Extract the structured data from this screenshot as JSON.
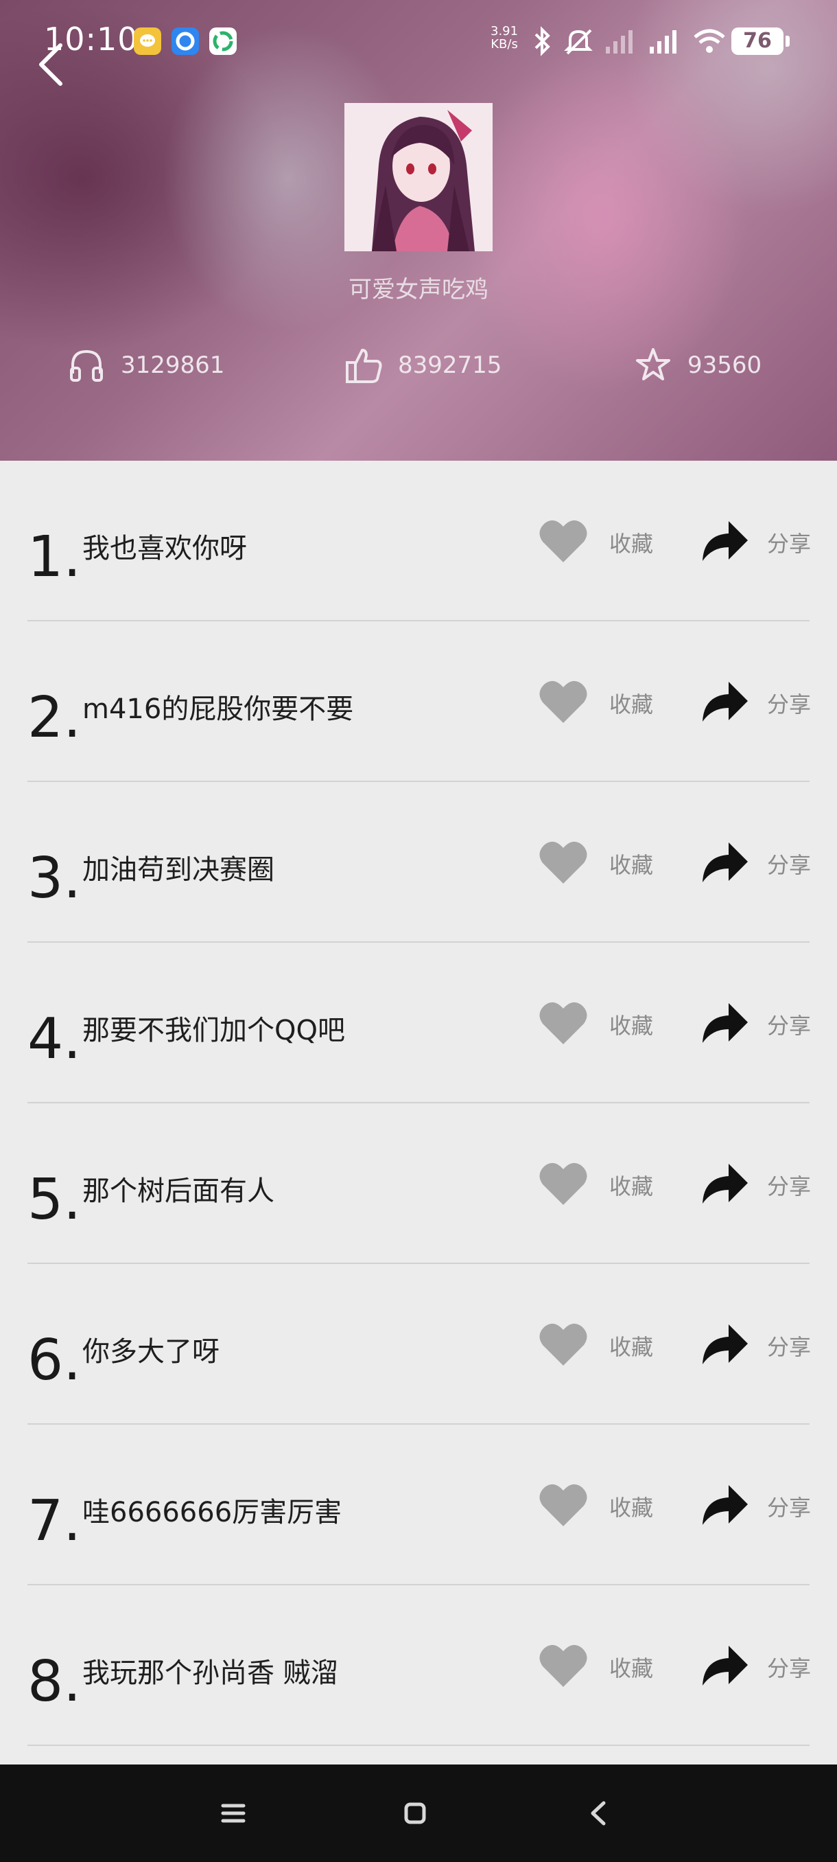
{
  "status_bar": {
    "time": "10:10",
    "net_speed_value": "3.91",
    "net_speed_unit": "KB/s",
    "battery": "76",
    "icons": [
      "bluetooth-icon",
      "mute-icon",
      "signal-icon",
      "signal-icon",
      "wifi-icon"
    ]
  },
  "header": {
    "title": "可爱女声吃鸡",
    "stats": [
      {
        "icon": "headphones-icon",
        "value": "3129861"
      },
      {
        "icon": "thumbs-up-icon",
        "value": "8392715"
      },
      {
        "icon": "star-icon",
        "value": "93560"
      }
    ]
  },
  "list": {
    "items": [
      {
        "num": "1.",
        "text": "我也喜欢你呀",
        "fav_label": "收藏",
        "share_label": "分享"
      },
      {
        "num": "2.",
        "text": "m416的屁股你要不要",
        "fav_label": "收藏",
        "share_label": "分享"
      },
      {
        "num": "3.",
        "text": "加油苟到决赛圈",
        "fav_label": "收藏",
        "share_label": "分享"
      },
      {
        "num": "4.",
        "text": "那要不我们加个QQ吧",
        "fav_label": "收藏",
        "share_label": "分享"
      },
      {
        "num": "5.",
        "text": "那个树后面有人",
        "fav_label": "收藏",
        "share_label": "分享"
      },
      {
        "num": "6.",
        "text": "你多大了呀",
        "fav_label": "收藏",
        "share_label": "分享"
      },
      {
        "num": "7.",
        "text": "哇6666666厉害厉害",
        "fav_label": "收藏",
        "share_label": "分享"
      },
      {
        "num": "8.",
        "text": "我玩那个孙尚香 贼溜",
        "fav_label": "收藏",
        "share_label": "分享"
      }
    ]
  },
  "nav_bar": {
    "buttons": [
      "menu-icon",
      "home-icon",
      "back-icon"
    ]
  },
  "colors": {
    "header_tint": "#9a6a86",
    "list_background": "#ececec",
    "heart": "#a6a6a6",
    "share_arrow": "#111111",
    "nav_background": "#111111"
  }
}
